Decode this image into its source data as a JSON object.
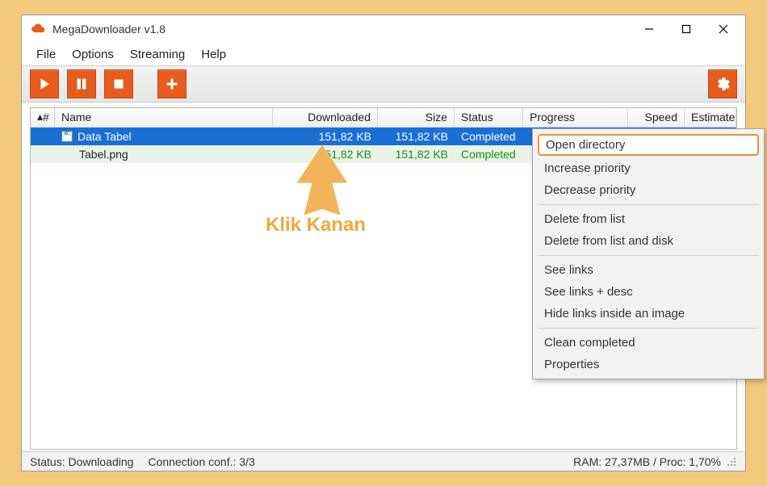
{
  "title": "MegaDownloader v1.8",
  "menu": {
    "file": "File",
    "options": "Options",
    "streaming": "Streaming",
    "help": "Help"
  },
  "columns": {
    "num": "#",
    "name": "Name",
    "downloaded": "Downloaded",
    "size": "Size",
    "status": "Status",
    "progress": "Progress",
    "speed": "Speed",
    "estimated": "Estimated"
  },
  "rows": [
    {
      "icon": "disk",
      "name": "Data Tabel",
      "downloaded": "151,82 KB",
      "size": "151,82 KB",
      "status": "Completed",
      "selected": true
    },
    {
      "icon": "",
      "name": "Tabel.png",
      "downloaded": "151,82 KB",
      "size": "151,82 KB",
      "status": "Completed",
      "selected": false
    }
  ],
  "context_menu": {
    "open_directory": "Open directory",
    "increase_priority": "Increase priority",
    "decrease_priority": "Decrease priority",
    "delete_from_list": "Delete from list",
    "delete_from_list_and_disk": "Delete from list and disk",
    "see_links": "See links",
    "see_links_desc": "See links + desc",
    "hide_links": "Hide links inside an image",
    "clean_completed": "Clean completed",
    "properties": "Properties"
  },
  "annotation": {
    "label": "Klik Kanan"
  },
  "statusbar": {
    "status": "Status: Downloading",
    "conn": "Connection conf.: 3/3",
    "ram": "RAM: 27,37MB / Proc: 1,70%"
  }
}
